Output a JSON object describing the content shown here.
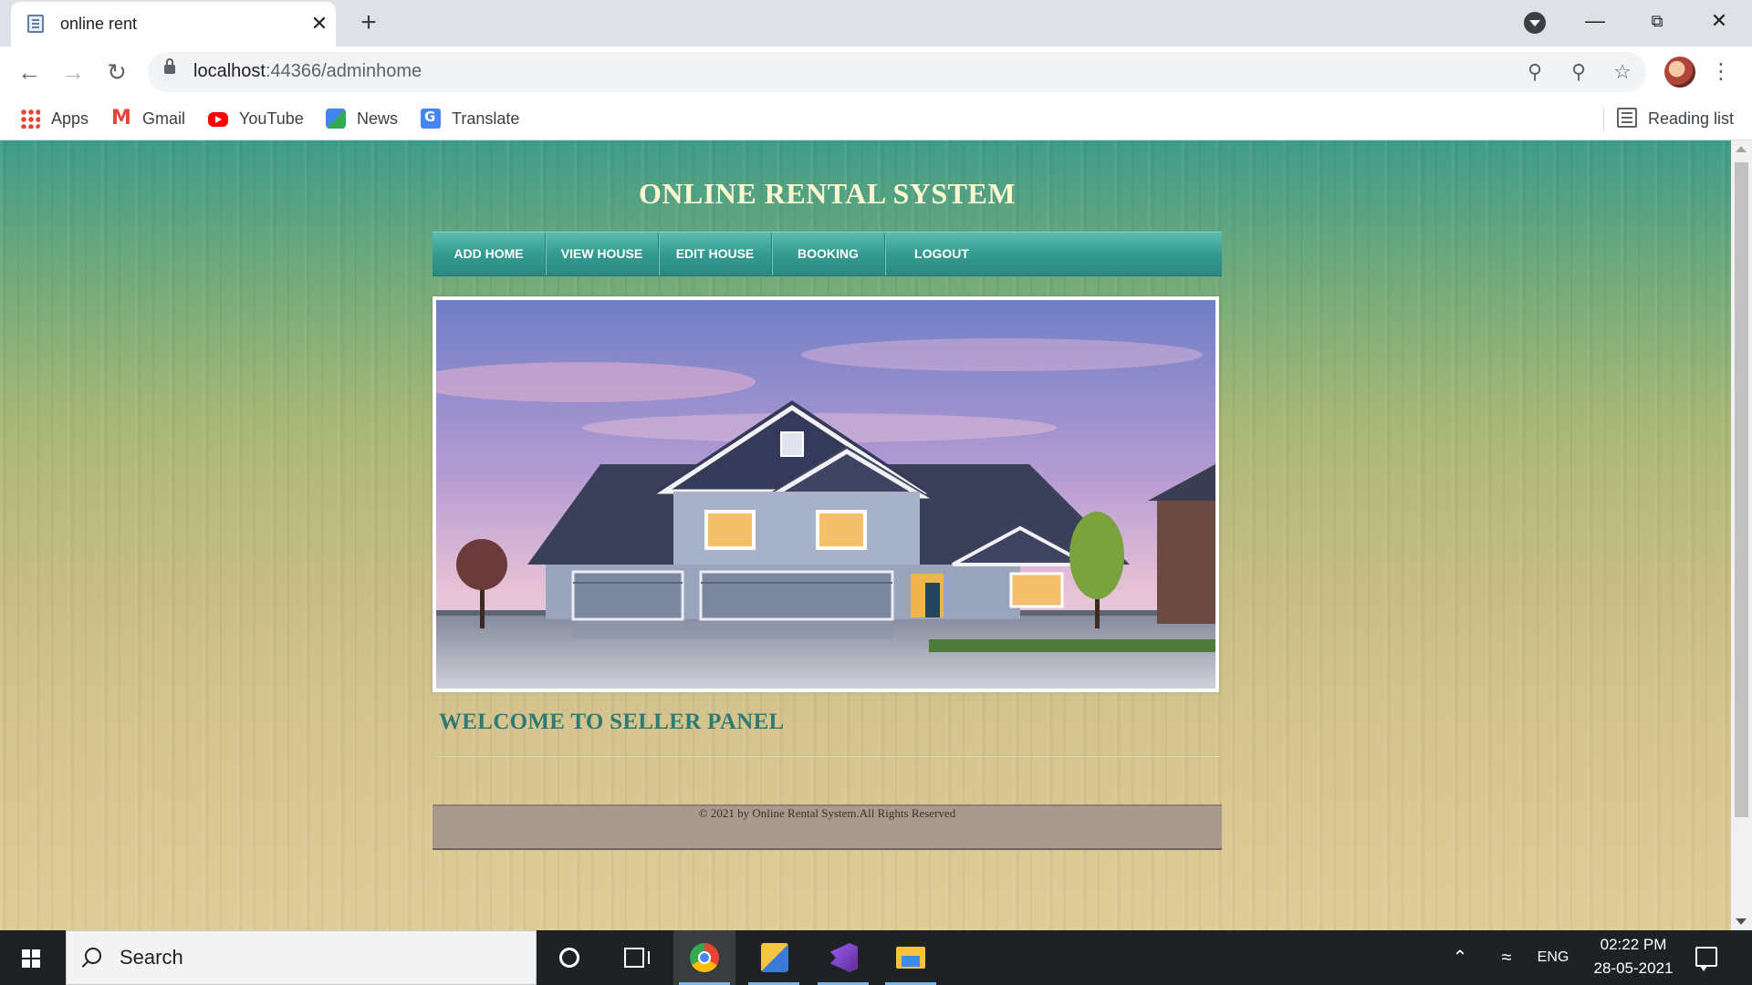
{
  "browser": {
    "tab_title": "online rent",
    "tab_close": "✕",
    "new_tab": "+",
    "url_host": "localhost",
    "url_path": ":44366/adminhome",
    "bookmarks": [
      {
        "label": "Apps",
        "icon": "apps-icon"
      },
      {
        "label": "Gmail",
        "icon": "gmail-icon"
      },
      {
        "label": "YouTube",
        "icon": "youtube-icon"
      },
      {
        "label": "News",
        "icon": "news-icon"
      },
      {
        "label": "Translate",
        "icon": "translate-icon"
      }
    ],
    "reading_list": "Reading list"
  },
  "site": {
    "title": "ONLINE RENTAL SYSTEM",
    "nav": [
      "ADD HOME",
      "VIEW HOUSE",
      "EDIT HOUSE",
      "BOOKING",
      "LOGOUT"
    ],
    "welcome": "WELCOME TO SELLER PANEL",
    "footer": "© 2021 by Online Rental System.All Rights Reserved",
    "colors": {
      "nav": "#349b91",
      "title": "#fff7cf",
      "welcome": "#2f7a73",
      "footer_bg": "#a89a8f"
    }
  },
  "taskbar": {
    "search_placeholder": "Search",
    "language": "ENG",
    "time": "02:22 PM",
    "date": "28-05-2021",
    "pinned": [
      "chrome-icon",
      "expression-blend-icon",
      "visual-studio-icon",
      "file-explorer-icon"
    ]
  }
}
